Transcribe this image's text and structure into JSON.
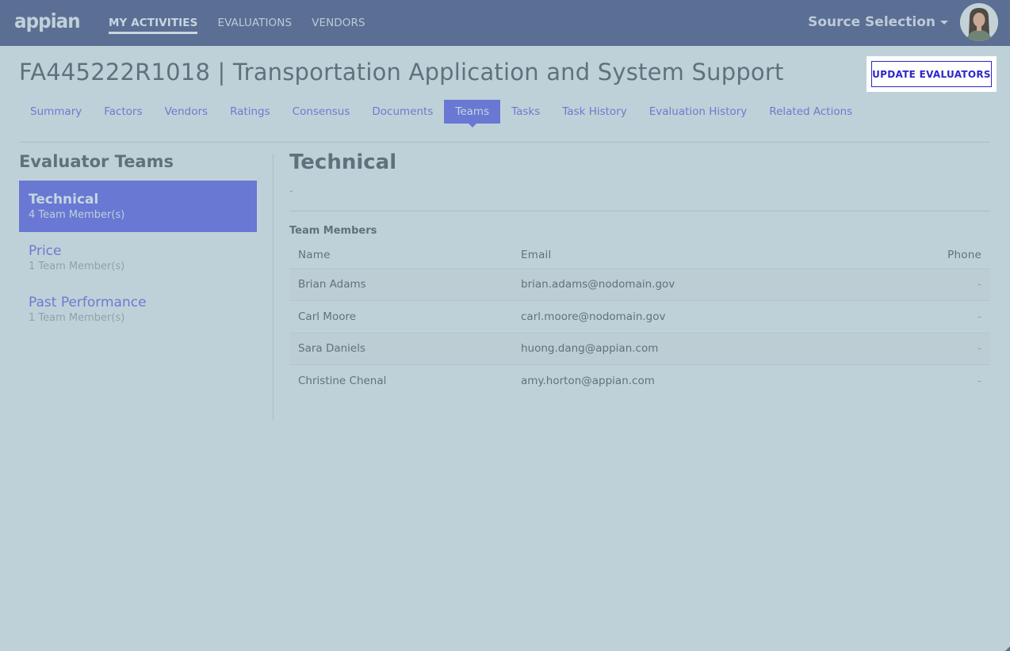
{
  "topbar": {
    "logo": "appian",
    "nav": [
      {
        "label": "MY ACTIVITIES",
        "active": true
      },
      {
        "label": "EVALUATIONS",
        "active": false
      },
      {
        "label": "VENDORS",
        "active": false
      }
    ],
    "app_switcher": "Source Selection",
    "avatar_icon": "user-avatar"
  },
  "header": {
    "title": "FA445222R1018 | Transportation Application and System Support",
    "update_button": "UPDATE EVALUATORS"
  },
  "tabs": [
    {
      "label": "Summary",
      "active": false
    },
    {
      "label": "Factors",
      "active": false
    },
    {
      "label": "Vendors",
      "active": false
    },
    {
      "label": "Ratings",
      "active": false
    },
    {
      "label": "Consensus",
      "active": false
    },
    {
      "label": "Documents",
      "active": false
    },
    {
      "label": "Teams",
      "active": true
    },
    {
      "label": "Tasks",
      "active": false
    },
    {
      "label": "Task History",
      "active": false
    },
    {
      "label": "Evaluation History",
      "active": false
    },
    {
      "label": "Related Actions",
      "active": false
    }
  ],
  "evaluator_teams": {
    "heading": "Evaluator Teams",
    "teams": [
      {
        "name": "Technical",
        "count": "4 Team Member(s)",
        "active": true
      },
      {
        "name": "Price",
        "count": "1 Team Member(s)",
        "active": false
      },
      {
        "name": "Past Performance",
        "count": "1 Team Member(s)",
        "active": false
      }
    ]
  },
  "detail": {
    "title": "Technical",
    "description": "-",
    "members_label": "Team Members",
    "columns": [
      "Name",
      "Email",
      "Phone"
    ],
    "members": [
      {
        "name": "Brian Adams",
        "email": "brian.adams@nodomain.gov",
        "phone": "-"
      },
      {
        "name": "Carl Moore",
        "email": "carl.moore@nodomain.gov",
        "phone": "-"
      },
      {
        "name": "Sara Daniels",
        "email": "huong.dang@appian.com",
        "phone": "-"
      },
      {
        "name": "Christine Chenal",
        "email": "amy.horton@appian.com",
        "phone": "-"
      }
    ]
  },
  "colors": {
    "topbar": "#5b6e94",
    "overlay_bg": "#bfd1d8",
    "accent": "#6978d3",
    "button_text": "#2d27c9"
  }
}
